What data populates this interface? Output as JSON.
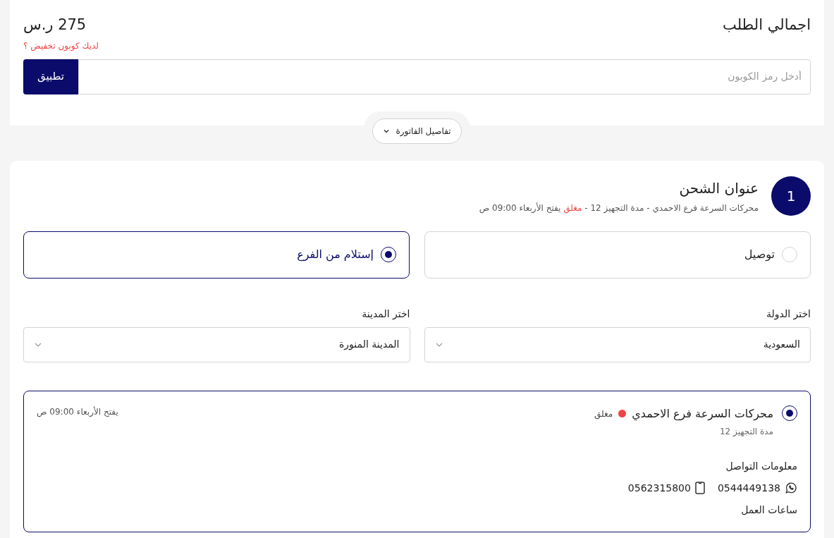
{
  "order_summary": {
    "title": "اجمالي الطلب",
    "total": "275 ر.س",
    "coupon_prompt": "لديك كوبون تخفيض ؟",
    "coupon_input": {
      "placeholder": "أدخل رمز الكوبون"
    },
    "apply_button": "تطبيق",
    "invoice_toggle": "تفاصيل الفاتورة"
  },
  "shipping": {
    "step": "1",
    "title": "عنوان الشحن",
    "summary_prefix": "محركات السرعة فرع الاحمدي - مدة التجهيز 12 - ",
    "summary_status": "مغلق",
    "summary_opening": " يفتح الأربعاء 09:00 ص",
    "methods": [
      {
        "label": "توصيل",
        "selected": false
      },
      {
        "label": "إستلام من الفرع",
        "selected": true
      }
    ],
    "selects": [
      {
        "label": "اختر الدولة",
        "value": "السعودية"
      },
      {
        "label": "اختر المدينة",
        "value": "المدينة المنورة"
      }
    ],
    "branches": [
      {
        "name": "محركات السرعة فرع الاحمدي",
        "selected": true,
        "status": "مغلق",
        "color": "#ef4444",
        "prep_time": "مدة التجهيز 12",
        "opening": "يفتح الأربعاء 09:00 ص",
        "contact_title": "معلومات التواصل",
        "whatsapp": "0544449138",
        "mobile": "0562315800",
        "hours_title": "ساعات العمل"
      }
    ]
  }
}
